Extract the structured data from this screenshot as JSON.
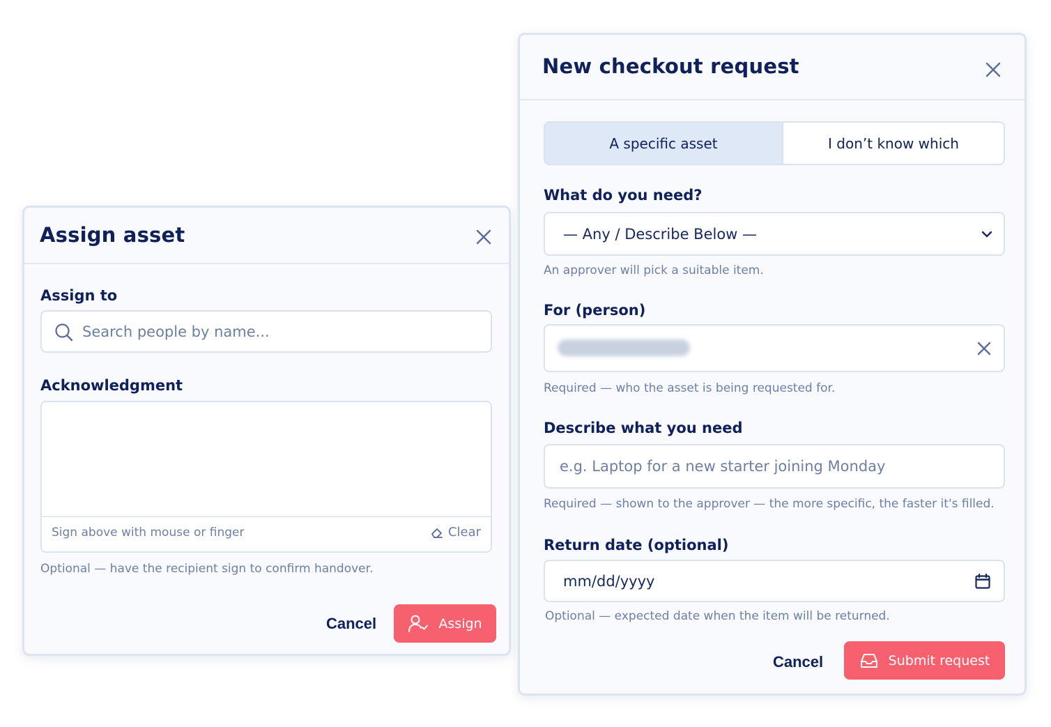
{
  "assign_dialog": {
    "title": "Assign asset",
    "assign_to_label": "Assign to",
    "search_placeholder": "Search people by name...",
    "acknowledgment_label": "Acknowledgment",
    "signature_hint": "Sign above with mouse or finger",
    "clear_label": "Clear",
    "acknowledgment_helper": "Optional — have the recipient sign to confirm handover.",
    "cancel_label": "Cancel",
    "assign_label": "Assign"
  },
  "checkout_dialog": {
    "title": "New checkout request",
    "tabs": [
      {
        "label": "A specific asset",
        "active": true
      },
      {
        "label": "I don’t know which",
        "active": false
      }
    ],
    "need_label": "What do you need?",
    "need_selected": "— Any / Describe Below —",
    "need_helper": "An approver will pick a suitable item.",
    "person_label": "For (person)",
    "person_helper": "Required — who the asset is being requested for.",
    "describe_label": "Describe what you need",
    "describe_placeholder": "e.g. Laptop for a new starter joining Monday",
    "describe_helper": "Required — shown to the approver — the more specific, the faster it's filled.",
    "return_label": "Return date (optional)",
    "return_placeholder": "mm/dd/yyyy",
    "return_helper": "Optional — expected date when the item will be returned.",
    "cancel_label": "Cancel",
    "submit_label": "Submit request"
  },
  "icons": {
    "close": "close-icon",
    "search": "search-icon",
    "eraser": "eraser-icon",
    "user_check": "user-check-icon",
    "chevron": "chevron-down-icon",
    "calendar": "calendar-icon",
    "inbox": "inbox-icon"
  },
  "colors": {
    "primary": "#f7606f",
    "text": "#102159",
    "muted": "#6d7fa5",
    "border": "#dbe2ee",
    "tab_active_bg": "#dfe8f6"
  }
}
